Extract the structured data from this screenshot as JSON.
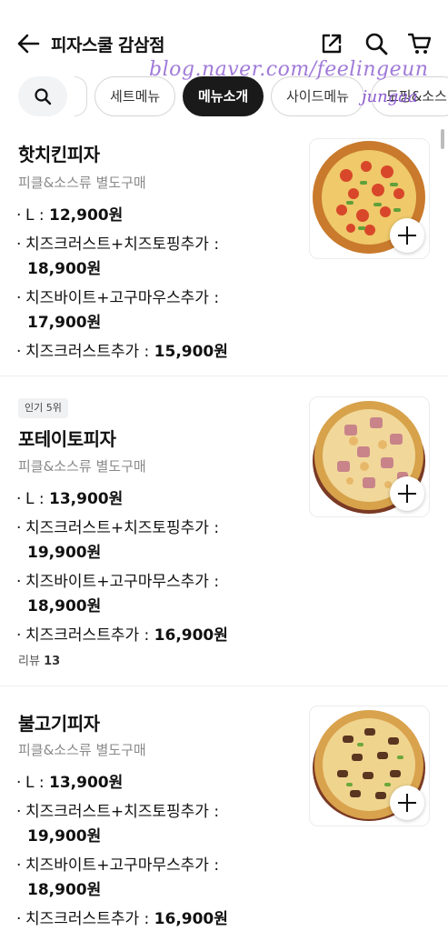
{
  "header": {
    "title": "피자스쿨 감삼점",
    "watermark": "blog.naver.com/feelingeun",
    "watermark_sub": "jungaa"
  },
  "tabs": {
    "items": [
      "세트메뉴",
      "메뉴소개",
      "사이드메뉴",
      "도핑&소스"
    ],
    "active": "메뉴소개"
  },
  "menu": [
    {
      "name": "핫치킨피자",
      "desc": "피클&소스류 별도구매",
      "lines": [
        {
          "label": "L : ",
          "price": "12,900원"
        },
        {
          "label": "치즈크러스트+치즈토핑추가 :",
          "price": "18,900원"
        },
        {
          "label": "치즈바이트+고구마우스추가 :",
          "price": "17,900원"
        },
        {
          "label": "치즈크러스트추가 : ",
          "price": "15,900원"
        }
      ]
    },
    {
      "badge": "인기 5위",
      "name": "포테이토피자",
      "desc": "피클&소스류 별도구매",
      "lines": [
        {
          "label": "L : ",
          "price": "13,900원"
        },
        {
          "label": "치즈크러스트+치즈토핑추가 :",
          "price": "19,900원"
        },
        {
          "label": "치즈바이트+고구마무스추가 :",
          "price": "18,900원"
        },
        {
          "label": "치즈크러스트추가 : ",
          "price": "16,900원"
        }
      ],
      "review_label": "리뷰",
      "review_count": "13"
    },
    {
      "name": "불고기피자",
      "desc": "피클&소스류 별도구매",
      "lines": [
        {
          "label": "L : ",
          "price": "13,900원"
        },
        {
          "label": "치즈크러스트+치즈토핑추가 :",
          "price": "19,900원"
        },
        {
          "label": "치즈바이트+고구마무스추가 :",
          "price": "18,900원"
        },
        {
          "label": "치즈크러스트추가 : ",
          "price": "16,900원"
        }
      ]
    }
  ],
  "colors": {
    "active_tab_bg": "#1a1a1a",
    "watermark": "#a07ad8",
    "desc_text": "#8a8a8a"
  },
  "icons": [
    "back-arrow-icon",
    "share-icon",
    "search-icon",
    "cart-icon",
    "plus-icon"
  ]
}
